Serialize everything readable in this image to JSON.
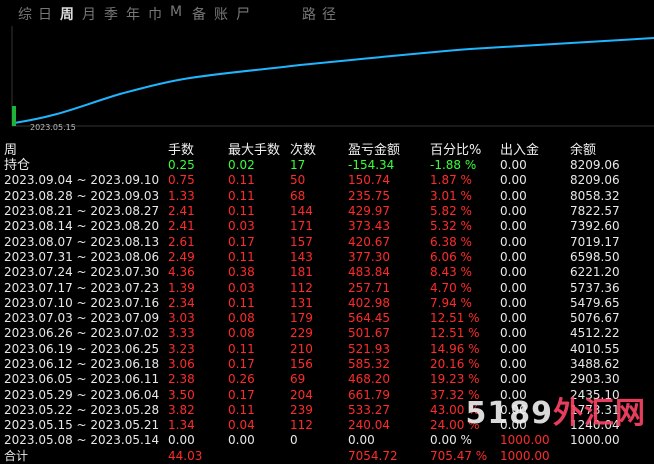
{
  "tabs": [
    "综",
    "日",
    "周",
    "月",
    "季",
    "年",
    "巾",
    "M",
    "备",
    "账",
    "尸",
    "",
    "",
    "路",
    "径"
  ],
  "active_tab": "周",
  "chart": {
    "start_label": "2023.05.15",
    "line_color": "#1fb6ff"
  },
  "table": {
    "headers": [
      "周",
      "手数",
      "最大手数",
      "次数",
      "盈亏金额",
      "百分比%",
      "出入金",
      "余额"
    ],
    "hold": {
      "label": "持仓",
      "lots": "0.25",
      "max": "0.02",
      "count": "17",
      "pnl": "-154.34",
      "pct": "-1.88 %",
      "inout": "0.00",
      "balance": "8209.06"
    },
    "rows": [
      {
        "period": "2023.09.04 ~ 2023.09.10",
        "lots": "0.75",
        "max": "0.11",
        "count": "50",
        "pnl": "150.74",
        "pct": "1.87 %",
        "inout": "0.00",
        "balance": "8209.06"
      },
      {
        "period": "2023.08.28 ~ 2023.09.03",
        "lots": "1.33",
        "max": "0.11",
        "count": "68",
        "pnl": "235.75",
        "pct": "3.01 %",
        "inout": "0.00",
        "balance": "8058.32"
      },
      {
        "period": "2023.08.21 ~ 2023.08.27",
        "lots": "2.41",
        "max": "0.11",
        "count": "144",
        "pnl": "429.97",
        "pct": "5.82 %",
        "inout": "0.00",
        "balance": "7822.57"
      },
      {
        "period": "2023.08.14 ~ 2023.08.20",
        "lots": "2.41",
        "max": "0.03",
        "count": "171",
        "pnl": "373.43",
        "pct": "5.32 %",
        "inout": "0.00",
        "balance": "7392.60"
      },
      {
        "period": "2023.08.07 ~ 2023.08.13",
        "lots": "2.61",
        "max": "0.17",
        "count": "157",
        "pnl": "420.67",
        "pct": "6.38 %",
        "inout": "0.00",
        "balance": "7019.17"
      },
      {
        "period": "2023.07.31 ~ 2023.08.06",
        "lots": "2.49",
        "max": "0.11",
        "count": "143",
        "pnl": "377.30",
        "pct": "6.06 %",
        "inout": "0.00",
        "balance": "6598.50"
      },
      {
        "period": "2023.07.24 ~ 2023.07.30",
        "lots": "4.36",
        "max": "0.38",
        "count": "181",
        "pnl": "483.84",
        "pct": "8.43 %",
        "inout": "0.00",
        "balance": "6221.20"
      },
      {
        "period": "2023.07.17 ~ 2023.07.23",
        "lots": "1.39",
        "max": "0.03",
        "count": "112",
        "pnl": "257.71",
        "pct": "4.70 %",
        "inout": "0.00",
        "balance": "5737.36"
      },
      {
        "period": "2023.07.10 ~ 2023.07.16",
        "lots": "2.34",
        "max": "0.11",
        "count": "131",
        "pnl": "402.98",
        "pct": "7.94 %",
        "inout": "0.00",
        "balance": "5479.65"
      },
      {
        "period": "2023.07.03 ~ 2023.07.09",
        "lots": "3.03",
        "max": "0.08",
        "count": "179",
        "pnl": "564.45",
        "pct": "12.51 %",
        "inout": "0.00",
        "balance": "5076.67"
      },
      {
        "period": "2023.06.26 ~ 2023.07.02",
        "lots": "3.33",
        "max": "0.08",
        "count": "229",
        "pnl": "501.67",
        "pct": "12.51 %",
        "inout": "0.00",
        "balance": "4512.22"
      },
      {
        "period": "2023.06.19 ~ 2023.06.25",
        "lots": "3.23",
        "max": "0.11",
        "count": "210",
        "pnl": "521.93",
        "pct": "14.96 %",
        "inout": "0.00",
        "balance": "4010.55"
      },
      {
        "period": "2023.06.12 ~ 2023.06.18",
        "lots": "3.06",
        "max": "0.17",
        "count": "156",
        "pnl": "585.32",
        "pct": "20.16 %",
        "inout": "0.00",
        "balance": "3488.62"
      },
      {
        "period": "2023.06.05 ~ 2023.06.11",
        "lots": "2.38",
        "max": "0.26",
        "count": "69",
        "pnl": "468.20",
        "pct": "19.23 %",
        "inout": "0.00",
        "balance": "2903.30"
      },
      {
        "period": "2023.05.29 ~ 2023.06.04",
        "lots": "3.50",
        "max": "0.17",
        "count": "204",
        "pnl": "661.79",
        "pct": "37.32 %",
        "inout": "0.00",
        "balance": "2435.10"
      },
      {
        "period": "2023.05.22 ~ 2023.05.28",
        "lots": "3.82",
        "max": "0.11",
        "count": "239",
        "pnl": "533.27",
        "pct": "43.00 %",
        "inout": "0.00",
        "balance": "1773.31"
      },
      {
        "period": "2023.05.15 ~ 2023.05.21",
        "lots": "1.34",
        "max": "0.04",
        "count": "112",
        "pnl": "240.04",
        "pct": "24.00 %",
        "inout": "0.00",
        "balance": "1240.04"
      },
      {
        "period": "2023.05.08 ~ 2023.05.14",
        "lots": "0.00",
        "max": "0.00",
        "count": "0",
        "pnl": "0.00",
        "pct": "0.00 %",
        "inout": "1000.00",
        "balance": "1000.00"
      }
    ],
    "total": {
      "label": "合计",
      "lots": "44.03",
      "pnl": "7054.72",
      "pct": "705.47 %",
      "inout": "1000.00"
    }
  },
  "watermark": {
    "text1": "5189",
    "text2": "外汇网"
  }
}
